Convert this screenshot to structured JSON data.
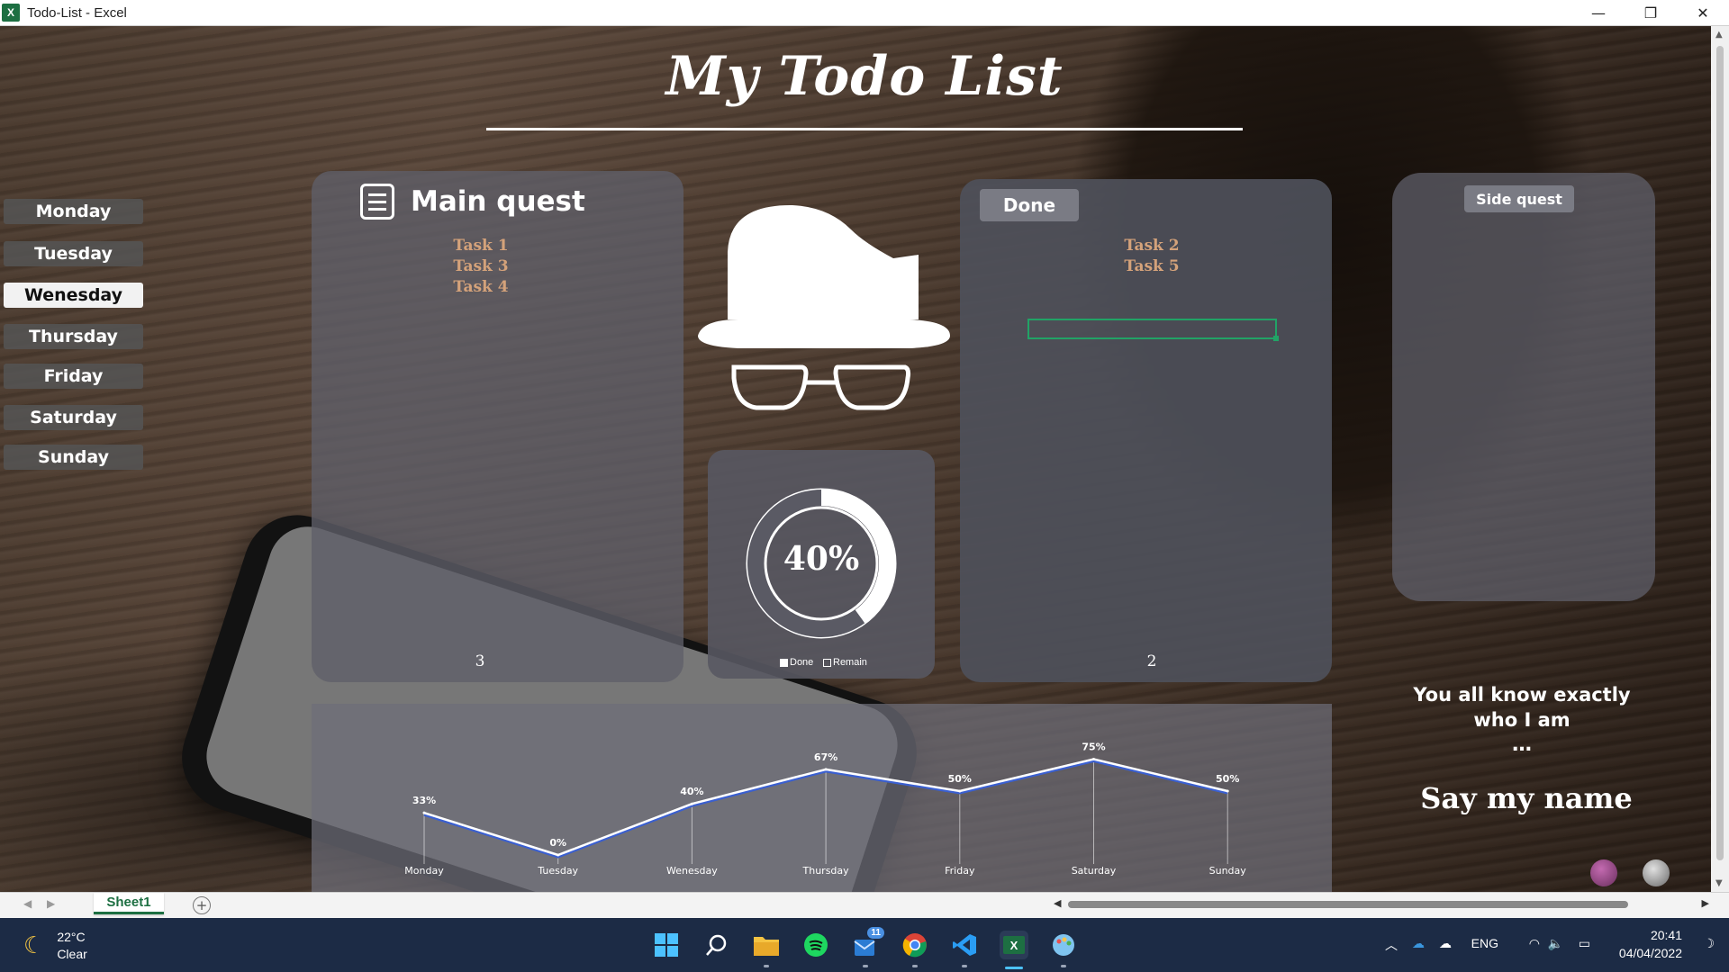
{
  "window": {
    "title": "Todo-List - Excel",
    "app_icon": "excel-icon",
    "minimize": "—",
    "restore": "❐",
    "close": "✕"
  },
  "dashboard": {
    "title": "My Todo List",
    "days": [
      "Monday",
      "Tuesday",
      "Wenesday",
      "Thursday",
      "Friday",
      "Saturday",
      "Sunday"
    ],
    "active_day": "Wenesday",
    "main_quest": {
      "title": "Main quest",
      "tasks": [
        "Task 1",
        "Task 3",
        "Task 4"
      ],
      "count": "3"
    },
    "done": {
      "title": "Done",
      "tasks": [
        "Task 2",
        "Task 5"
      ],
      "count": "2"
    },
    "side_quest": {
      "title": "Side quest"
    },
    "quote": {
      "line1": "You all know exactly",
      "line2": "who I am",
      "dots": "…",
      "name": "Say my name"
    }
  },
  "chart_data": [
    {
      "type": "pie",
      "labels": [
        "Done",
        "Remain"
      ],
      "values": [
        40,
        60
      ],
      "center_label": "40%",
      "legend_position": "bottom",
      "colors": {
        "Done": "#ffffff",
        "Remain": "#5a5a64"
      }
    },
    {
      "type": "line",
      "categories": [
        "Monday",
        "Tuesday",
        "Wenesday",
        "Thursday",
        "Friday",
        "Saturday",
        "Sunday"
      ],
      "values": [
        33,
        0,
        40,
        67,
        50,
        75,
        50
      ],
      "data_labels": [
        "33%",
        "0%",
        "40%",
        "67%",
        "50%",
        "75%",
        "50%"
      ],
      "ylim": [
        0,
        100
      ],
      "drop_lines": true,
      "colors": {
        "line": "#ffffff"
      }
    }
  ],
  "sheet_tabs": {
    "active": "Sheet1",
    "add_label": "+"
  },
  "taskbar": {
    "weather_temp": "22°C",
    "weather_desc": "Clear",
    "notification_badge": "11",
    "language": "ENG",
    "time": "20:41",
    "date": "04/04/2022"
  }
}
